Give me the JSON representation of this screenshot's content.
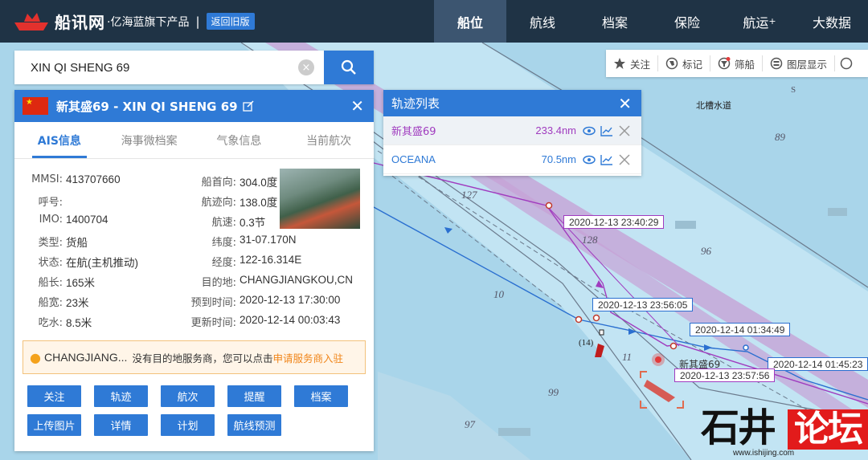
{
  "header": {
    "logo_text": "船讯网",
    "logo_sub": "·亿海蓝旗下产品",
    "logo_sep": "|",
    "back_label": "返回旧版",
    "nav": [
      {
        "label": "船位",
        "active": true
      },
      {
        "label": "航线"
      },
      {
        "label": "档案"
      },
      {
        "label": "保险"
      },
      {
        "label": "航运",
        "sup": "+"
      },
      {
        "label": "大数据"
      }
    ]
  },
  "search": {
    "value": "XIN QI SHENG 69",
    "clear_icon": "×"
  },
  "ship_panel": {
    "title": "新其盛69 -  XIN QI SHENG 69",
    "close": "✕",
    "tabs": [
      "AIS信息",
      "海事微档案",
      "气象信息",
      "当前航次"
    ],
    "active_tab": 0,
    "left_fields": [
      {
        "label": "MMSI:",
        "value": "413707660"
      },
      {
        "label": "呼号:",
        "value": ""
      },
      {
        "label": "IMO:",
        "value": "1400704"
      },
      {
        "label": "类型:",
        "value": "货船"
      },
      {
        "label": "状态:",
        "value": "在航(主机推动)"
      },
      {
        "label": "船长:",
        "value": "165米"
      },
      {
        "label": "船宽:",
        "value": "23米"
      },
      {
        "label": "吃水:",
        "value": "8.5米"
      }
    ],
    "right_fields": [
      {
        "label": "船首向:",
        "value": "304.0度"
      },
      {
        "label": "航迹向:",
        "value": "138.0度"
      },
      {
        "label": "航速:",
        "value": "0.3节"
      },
      {
        "label": "纬度:",
        "value": "31-07.170N"
      },
      {
        "label": "经度:",
        "value": "122-16.314E"
      },
      {
        "label": "目的地:",
        "value": "CHANGJIANGKOU,CN"
      },
      {
        "label": "预到时间:",
        "value": "2020-12-13 17:30:00"
      },
      {
        "label": "更新时间:",
        "value": "2020-12-14 00:03:43"
      }
    ],
    "notice": {
      "dest": "CHANGJIANG...",
      "text": "没有目的地服务商，您可以点击",
      "link": "申请服务商入驻"
    },
    "buttons": [
      "关注",
      "轨迹",
      "航次",
      "提醒",
      "档案",
      "上传图片",
      "详情",
      "计划",
      "航线预测"
    ]
  },
  "track_panel": {
    "title": "轨迹列表",
    "close": "✕",
    "rows": [
      {
        "name": "新其盛69",
        "dist": "233.4nm",
        "color": "#a03cbf"
      },
      {
        "name": "OCEANA",
        "dist": "70.5nm",
        "color": "#2f7ad6"
      }
    ]
  },
  "map_toolbar": [
    "关注",
    "标记",
    "筛船",
    "图层显示"
  ],
  "map": {
    "labels": [
      "2020-12-13 23:40:29",
      "2020-12-13 23:56:05",
      "2020-12-14 01:34:49",
      "2020-12-14 01:45:23",
      "2020-12-13 23:57:56"
    ],
    "ship_label": "新其盛69",
    "area_name": "北槽水道",
    "depths": [
      "127",
      "128",
      "96",
      "10",
      "89",
      "99",
      "97",
      "11",
      "(14)",
      "S"
    ]
  },
  "watermark": {
    "black": "石井",
    "red": "论坛",
    "url": "www.ishijing.com"
  },
  "colors": {
    "accent": "#2f7ad6",
    "topbar": "#1f3345",
    "track_purple": "#a03cbf",
    "track_blue": "#2a6fd0",
    "notice_link": "#f08519"
  }
}
